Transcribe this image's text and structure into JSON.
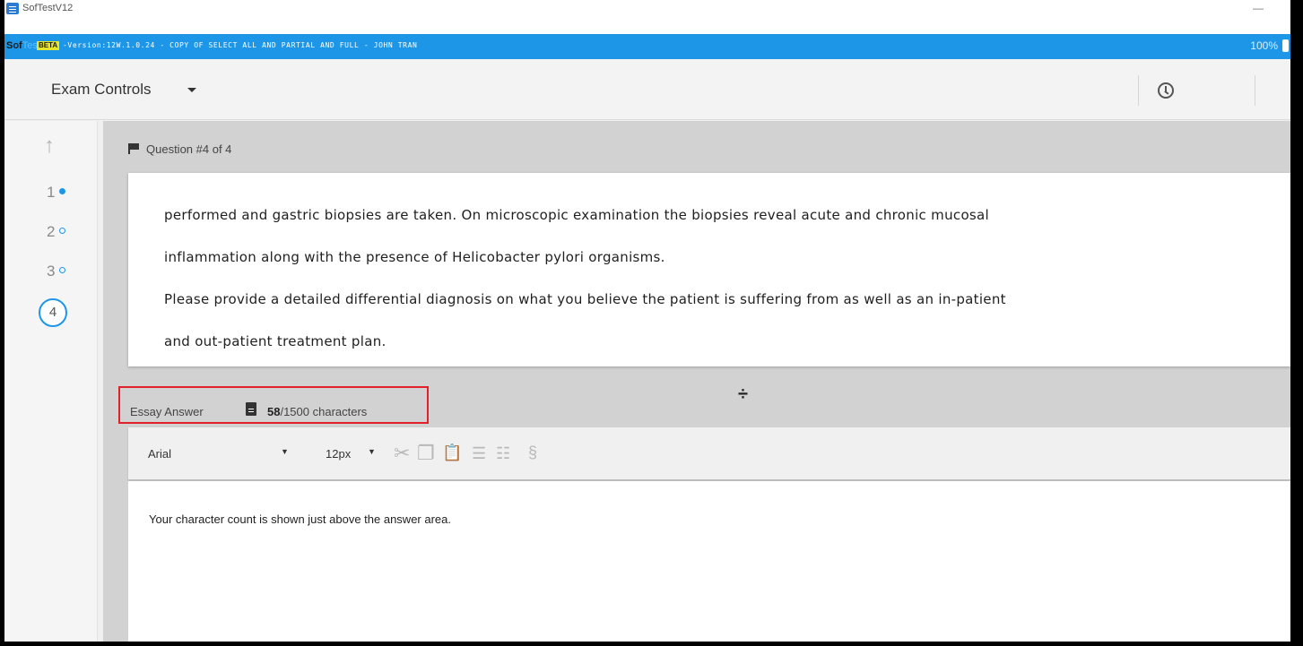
{
  "window": {
    "title": "SofTestV12",
    "minimize": "—"
  },
  "banner": {
    "brand_soft": "Sof",
    "brand_test": "Test",
    "beta": "BETA",
    "version": "-Version:12W.1.0.24 - COPY OF SELECT ALL AND PARTIAL AND FULL - JOHN TRAN",
    "battery": "100%"
  },
  "toolbar": {
    "exam_controls": "Exam Controls"
  },
  "nav": {
    "up": "↑",
    "questions": [
      {
        "label": "1",
        "state": "answered"
      },
      {
        "label": "2",
        "state": "unanswered"
      },
      {
        "label": "3",
        "state": "unanswered"
      },
      {
        "label": "4",
        "state": "current"
      }
    ]
  },
  "question": {
    "header": "Question #4 of 4",
    "line1": "performed and gastric biopsies are taken. On microscopic examination the biopsies reveal acute and chronic mucosal",
    "line2": "inflammation along with the presence of Helicobacter pylori organisms.",
    "line3": "Please provide a detailed differential diagnosis on what you believe the patient is suffering from as well as an in-patient",
    "line4": "and out-patient treatment plan."
  },
  "answer": {
    "label": "Essay Answer",
    "count": "58",
    "limit": "/1500 characters",
    "split_icon": "÷",
    "font": "Arial",
    "font_caret": "▼",
    "size": "12px",
    "size_caret": "▼",
    "text": "Your character count is shown just above the answer area."
  },
  "icons": {
    "cut": "✂",
    "copy": "❐",
    "paste": "📋",
    "bullets": "☰",
    "numbered": "☷",
    "section": "§"
  },
  "colors": {
    "accent": "#1e96e8",
    "highlight": "#e0202a"
  }
}
